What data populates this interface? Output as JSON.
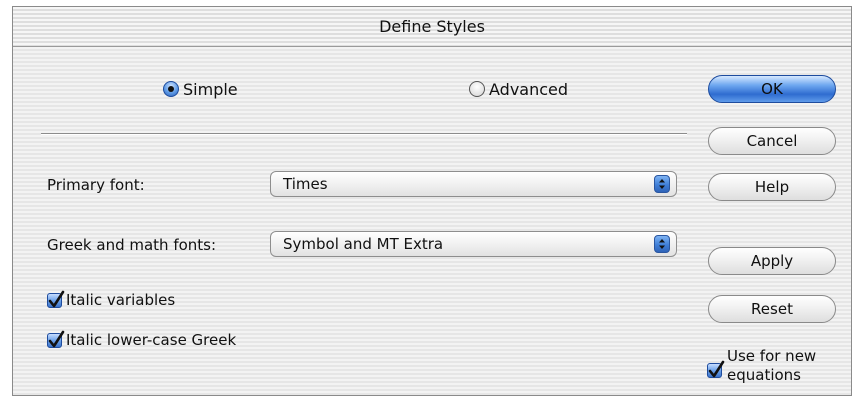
{
  "dialog": {
    "title": "Define Styles"
  },
  "mode": {
    "options": [
      {
        "label": "Simple",
        "selected": true
      },
      {
        "label": "Advanced",
        "selected": false
      }
    ]
  },
  "fields": {
    "primary_font": {
      "label": "Primary font:",
      "value": "Times"
    },
    "greek_math_fonts": {
      "label": "Greek and math fonts:",
      "value": "Symbol and MT Extra"
    }
  },
  "checkboxes": {
    "italic_variables": {
      "label": "Italic variables",
      "checked": true
    },
    "italic_lowercase_greek": {
      "label": "Italic lower-case Greek",
      "checked": true
    },
    "use_for_new_line1": "Use for new",
    "use_for_new_line2": "equations",
    "use_for_new_checked": true
  },
  "buttons": {
    "ok": "OK",
    "cancel": "Cancel",
    "help": "Help",
    "apply": "Apply",
    "reset": "Reset"
  },
  "colors": {
    "accent_blue": "#3f7fd8",
    "window_bg": "#ececec"
  }
}
